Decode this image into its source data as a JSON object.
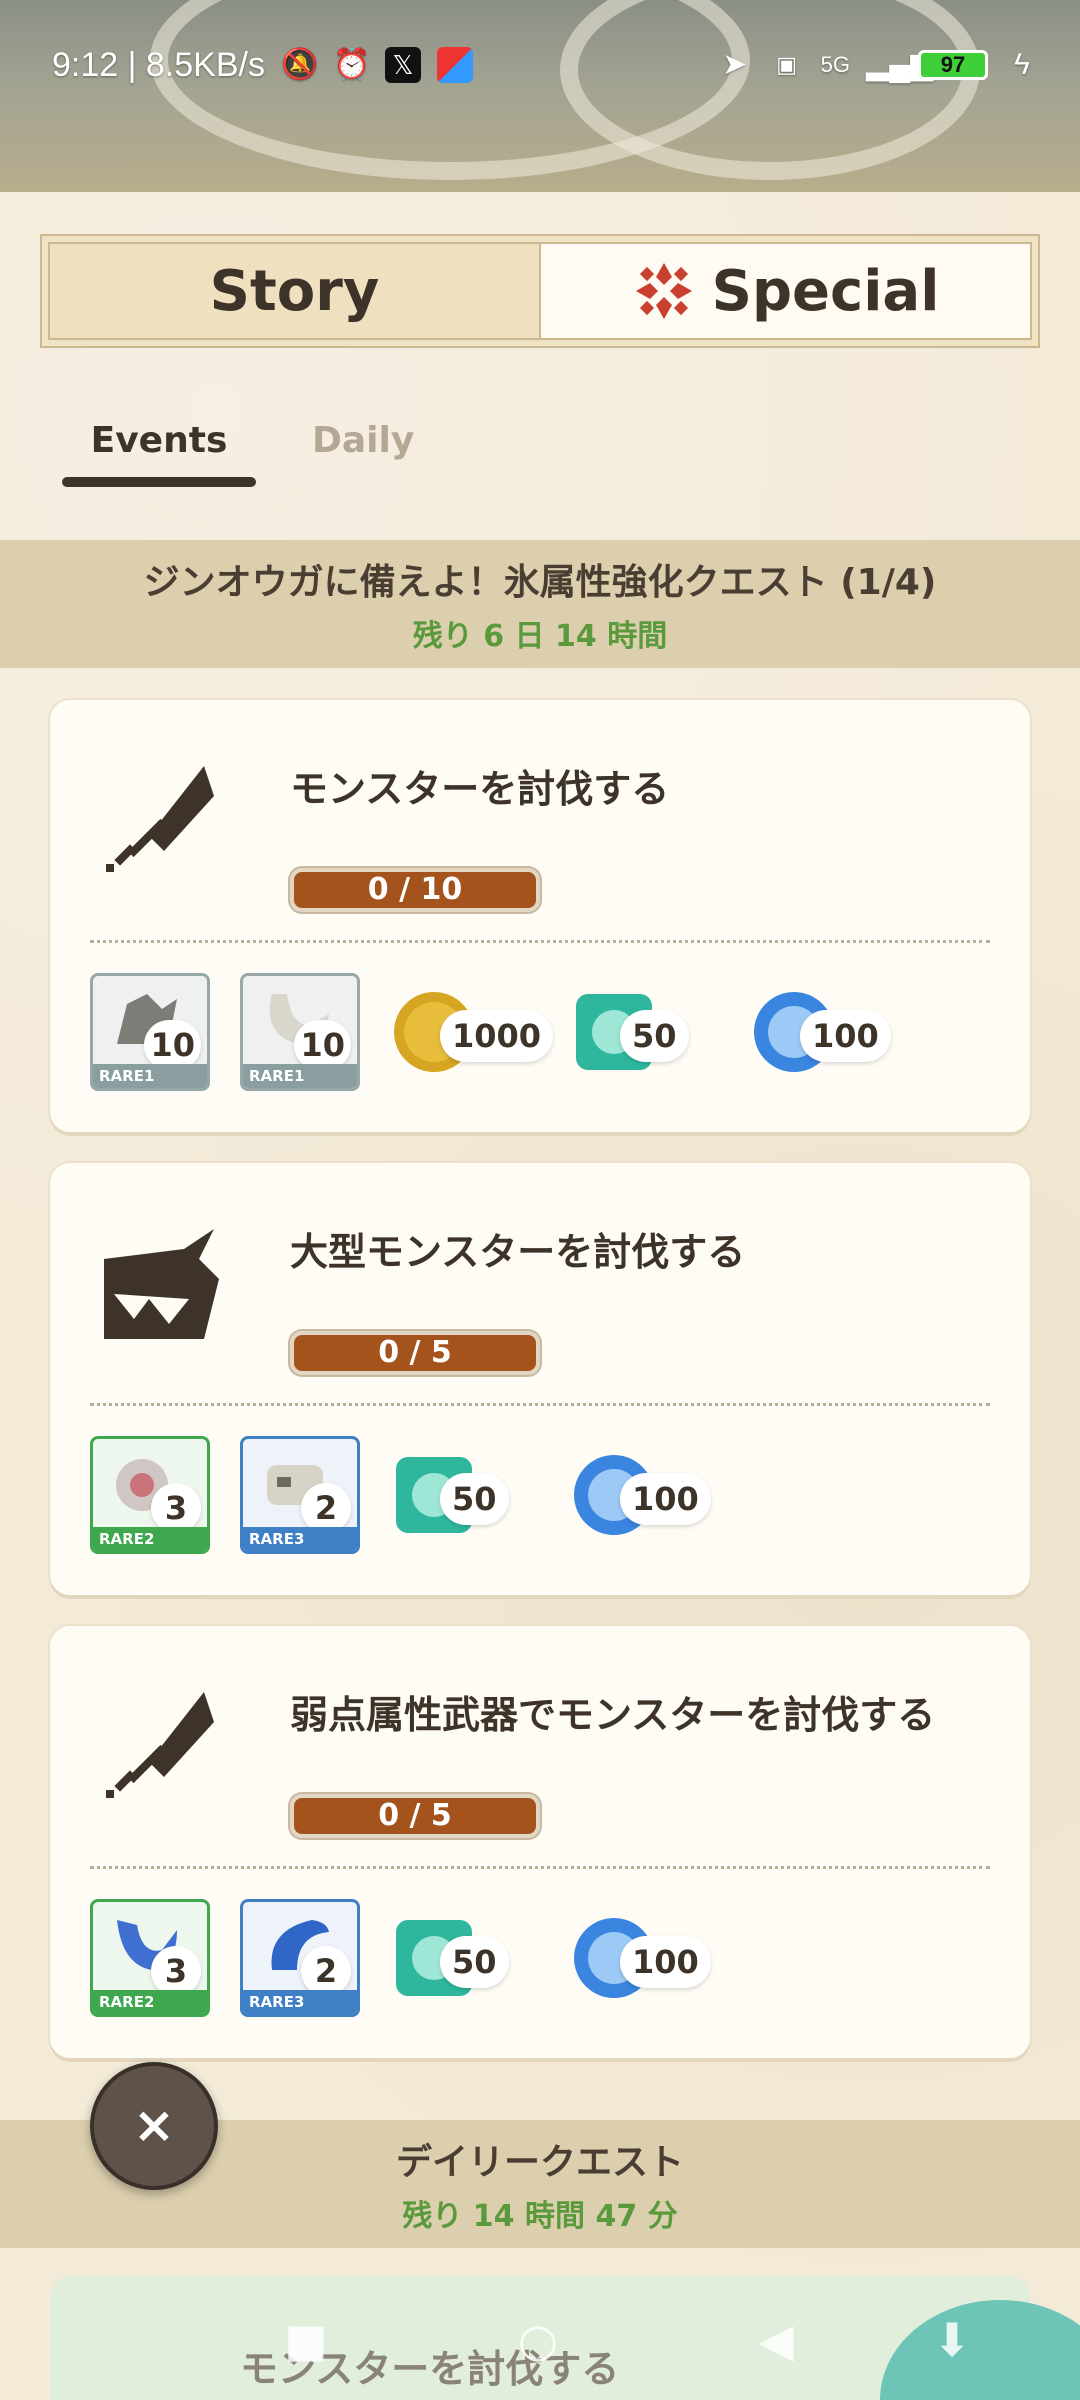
{
  "status_bar": {
    "time_speed": "9:12 | 8.5KB/s",
    "battery": "97",
    "network": "5G"
  },
  "main_tabs": {
    "story": "Story",
    "special": "Special"
  },
  "sub_tabs": {
    "events": "Events",
    "daily": "Daily"
  },
  "event_section": {
    "title": "ジンオウガに備えよ！氷属性強化クエスト (1/4)",
    "remaining": "残り 6 日 14 時間"
  },
  "quests": [
    {
      "icon": "sword-icon",
      "title": "モンスターを討伐する",
      "progress": "0 / 10",
      "items": [
        {
          "icon": "monster-bone-icon",
          "rarity": "RARE1",
          "qty": "10"
        },
        {
          "icon": "fang-icon",
          "rarity": "RARE1",
          "qty": "10"
        }
      ],
      "currencies": [
        {
          "icon": "gold-coin-icon",
          "amount": "1000"
        },
        {
          "icon": "green-gem-icon",
          "amount": "50"
        },
        {
          "icon": "ice-orb-icon",
          "amount": "100"
        }
      ]
    },
    {
      "icon": "large-monster-icon",
      "title": "大型モンスターを討伐する",
      "progress": "0 / 5",
      "items": [
        {
          "icon": "shell-icon",
          "rarity": "RARE2",
          "qty": "3"
        },
        {
          "icon": "skull-icon",
          "rarity": "RARE3",
          "qty": "2"
        }
      ],
      "currencies": [
        {
          "icon": "green-gem-icon",
          "amount": "50"
        },
        {
          "icon": "ice-orb-icon",
          "amount": "100"
        }
      ]
    },
    {
      "icon": "sword-icon",
      "title": "弱点属性武器でモンスターを討伐する",
      "progress": "0 / 5",
      "items": [
        {
          "icon": "blue-claw-icon",
          "rarity": "RARE2",
          "qty": "3"
        },
        {
          "icon": "blue-horn-icon",
          "rarity": "RARE3",
          "qty": "2"
        }
      ],
      "currencies": [
        {
          "icon": "green-gem-icon",
          "amount": "50"
        },
        {
          "icon": "ice-orb-icon",
          "amount": "100"
        }
      ]
    }
  ],
  "daily_section": {
    "title": "デイリークエスト",
    "remaining": "残り 14 時間 47 分"
  },
  "daily_first_quest_title": "モンスターを討伐する",
  "close_label": "×",
  "colors": {
    "progress_fill": "#a5531d",
    "remaining_text": "#5a9a3c",
    "rare1": "#8a9ea0",
    "rare2": "#3fa84f",
    "rare3": "#3f7fc6",
    "special_icon": "#c9402e"
  }
}
